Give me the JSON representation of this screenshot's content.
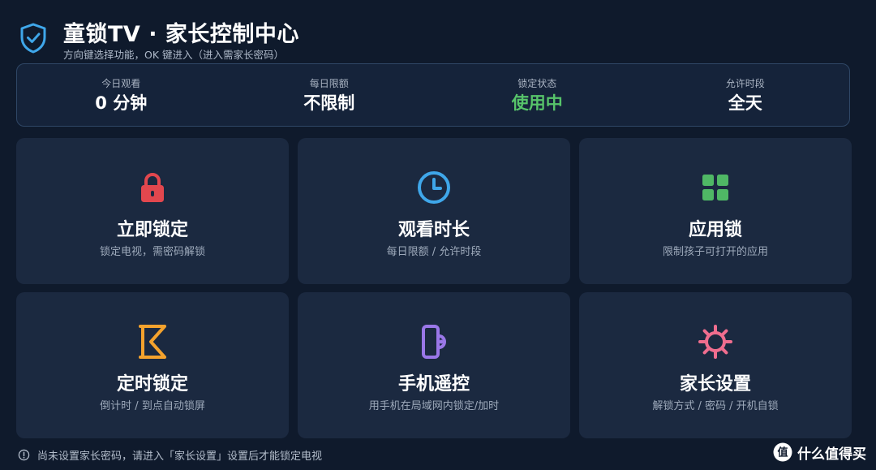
{
  "header": {
    "title": "童锁TV · 家长控制中心",
    "subtitle": "方向键选择功能，OK 键进入（进入需家长密码）"
  },
  "stats": [
    {
      "label": "今日观看",
      "value": "0 分钟"
    },
    {
      "label": "每日限额",
      "value": "不限制"
    },
    {
      "label": "锁定状态",
      "value": "使用中",
      "color": "#57c46a"
    },
    {
      "label": "允许时段",
      "value": "全天"
    }
  ],
  "tiles": [
    {
      "title": "立即锁定",
      "desc": "锁定电视，需密码解锁",
      "icon": "lock-icon",
      "color": "#e2474e"
    },
    {
      "title": "观看时长",
      "desc": "每日限额 / 允许时段",
      "icon": "clock-icon",
      "color": "#3fa7ea"
    },
    {
      "title": "应用锁",
      "desc": "限制孩子可打开的应用",
      "icon": "grid-icon",
      "color": "#4fb865"
    },
    {
      "title": "定时锁定",
      "desc": "倒计时 / 到点自动锁屏",
      "icon": "timer-icon",
      "color": "#f4a22d"
    },
    {
      "title": "手机遥控",
      "desc": "用手机在局域网内锁定/加时",
      "icon": "phone-icon",
      "color": "#9a77e8"
    },
    {
      "title": "家长设置",
      "desc": "解锁方式 / 密码 / 开机自锁",
      "icon": "gear-icon",
      "color": "#ef6d8e"
    }
  ],
  "footer": {
    "text": "尚未设置家长密码，请进入「家长设置」设置后才能锁定电视"
  },
  "watermark": {
    "badge": "值",
    "text": "什么值得买"
  },
  "colors": {
    "background": "#0f1a2c",
    "panel": "#15233a",
    "tile": "#1b2940",
    "accent": "#3fa7ea",
    "active": "#57c46a"
  }
}
